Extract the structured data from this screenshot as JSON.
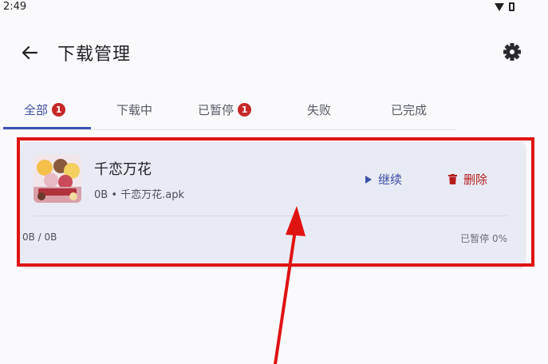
{
  "status_bar": {
    "time": "2:49",
    "icons": [
      "wifi-icon",
      "battery-icon"
    ]
  },
  "header": {
    "title": "下载管理",
    "back_icon": "arrow-left-icon",
    "settings_icon": "gear-icon"
  },
  "tabs": [
    {
      "label": "全部",
      "badge": "1",
      "active": true
    },
    {
      "label": "下载中",
      "badge": null,
      "active": false
    },
    {
      "label": "已暂停",
      "badge": "1",
      "active": false
    },
    {
      "label": "失败",
      "badge": null,
      "active": false
    },
    {
      "label": "已完成",
      "badge": null,
      "active": false
    }
  ],
  "download_item": {
    "title": "千恋万花",
    "subtitle": "0B • 千恋万花.apk",
    "resume_label": "继续",
    "delete_label": "删除",
    "bytes": "0B / 0B",
    "status": "已暂停 0%",
    "progress": 0
  },
  "colors": {
    "accent": "#3f51b5",
    "badge": "#c62828",
    "danger": "#b71c1c",
    "annotation": "#e01313"
  }
}
